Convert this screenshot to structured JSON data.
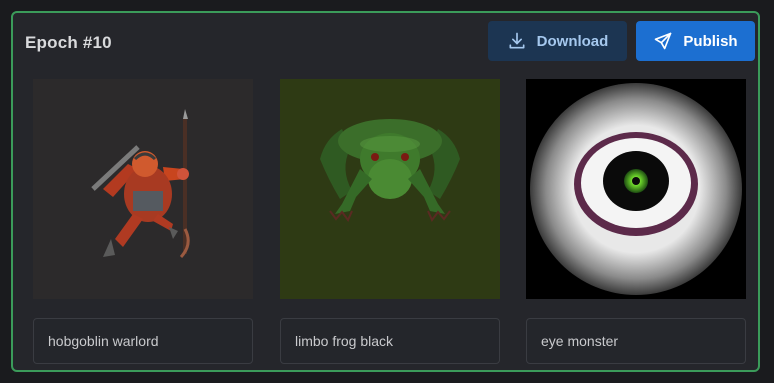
{
  "panel": {
    "title": "Epoch #10",
    "border_color": "#3b9b5a"
  },
  "actions": {
    "download_label": "Download",
    "download_icon": "download-icon",
    "publish_label": "Publish",
    "publish_icon": "send-icon",
    "publish_color": "#1c6fd1"
  },
  "cards": [
    {
      "caption": "hobgoblin warlord",
      "image": "red-armored-goblin-warrior-with-spear"
    },
    {
      "caption": "limbo frog black",
      "image": "green-frog-on-olive-background"
    },
    {
      "caption": "eye monster",
      "image": "giant-eyeball-with-green-iris"
    }
  ]
}
